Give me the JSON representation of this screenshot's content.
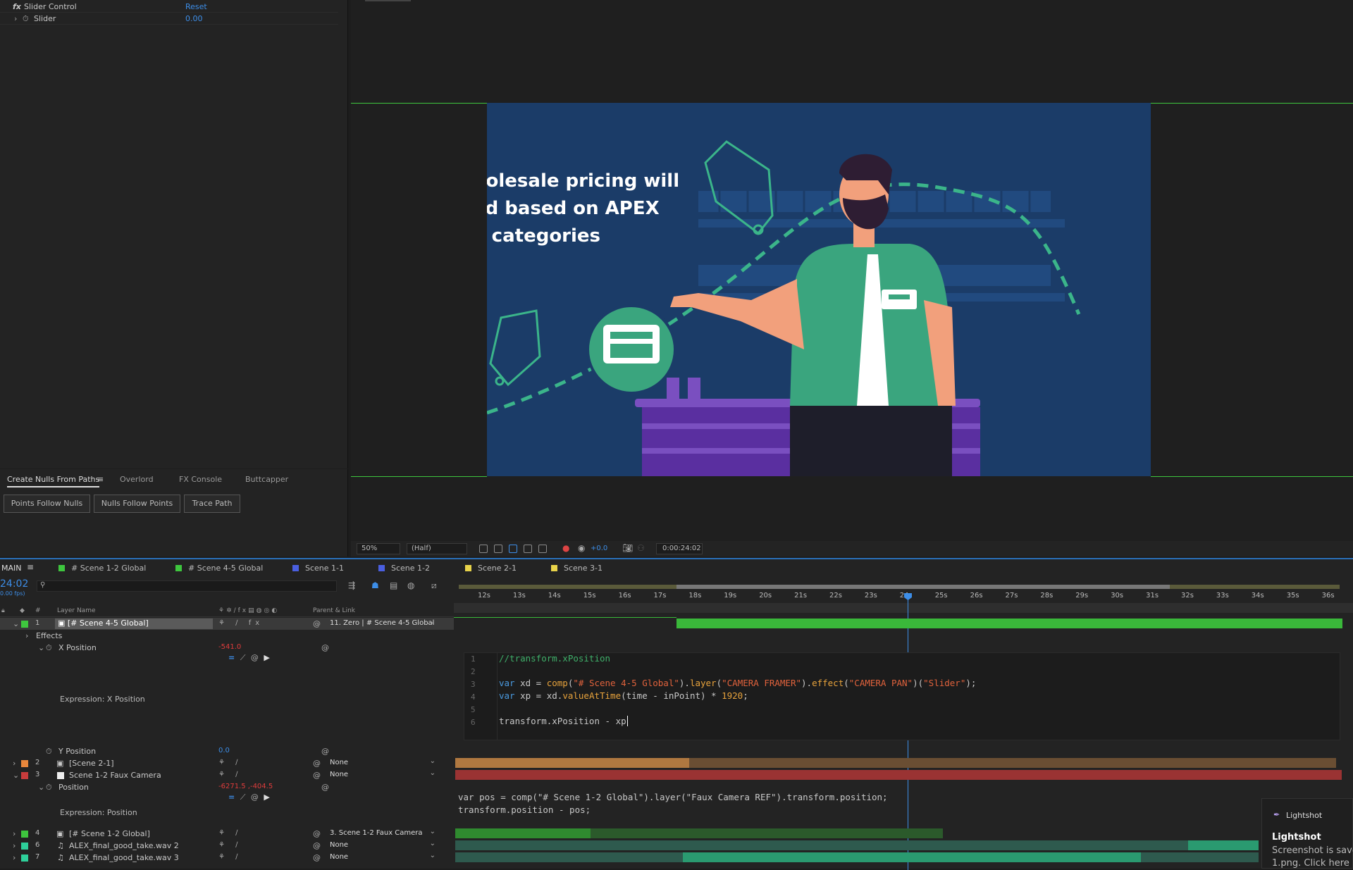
{
  "effect_controls": {
    "fx_label": "fx",
    "effect_name": "Slider Control",
    "reset_label": "Reset",
    "param_name": "Slider",
    "param_value": "0.00"
  },
  "script_panel": {
    "tabs": [
      "Create Nulls From Paths",
      "Overlord",
      "FX Console",
      "Buttcapper"
    ],
    "buttons": [
      "Points Follow Nulls",
      "Nulls Follow Points",
      "Trace Path"
    ]
  },
  "comp": {
    "text_lines": [
      "holesale pricing will",
      "ed based on APEX",
      "e categories"
    ]
  },
  "viewer_bar": {
    "zoom": "50%",
    "resolution": "(Half)",
    "exposure": "+0.0",
    "timecode": "0:00:24:02"
  },
  "timeline": {
    "panel_name": "MAIN",
    "timecode": "24:02",
    "fps": "0.00 fps)",
    "comp_tabs": [
      {
        "label": "# Scene 1-2 Global",
        "color": "#3ec63e"
      },
      {
        "label": "# Scene 4-5 Global",
        "color": "#3ec63e"
      },
      {
        "label": "Scene 1-1",
        "color": "#4a5fe0"
      },
      {
        "label": "Scene 1-2",
        "color": "#4a5fe0"
      },
      {
        "label": "Scene 2-1",
        "color": "#e8d34a"
      },
      {
        "label": "Scene 3-1",
        "color": "#e8d34a"
      }
    ],
    "headers": {
      "hash": "#",
      "layer_name": "Layer Name",
      "parent": "Parent & Link"
    },
    "ruler": [
      "12s",
      "13s",
      "14s",
      "15s",
      "16s",
      "17s",
      "18s",
      "19s",
      "20s",
      "21s",
      "22s",
      "23s",
      "24",
      "25s",
      "26s",
      "27s",
      "28s",
      "29s",
      "30s",
      "31s",
      "32s",
      "33s",
      "34s",
      "35s",
      "36s"
    ],
    "layers": [
      {
        "num": "1",
        "name": "[# Scene 4-5 Global]",
        "label_color": "#3ec63e",
        "parent": "11. Zero | # Scene 4-5 Global"
      },
      {
        "num": "2",
        "name": "[Scene 2-1]",
        "label_color": "#e8873c",
        "parent": "None"
      },
      {
        "num": "3",
        "name": "Scene 1-2 Faux Camera",
        "label_color": "#c83c3c",
        "parent": "None"
      },
      {
        "num": "4",
        "name": "[# Scene 1-2 Global]",
        "label_color": "#3ec63e",
        "parent": "3. Scene 1-2 Faux Camera"
      },
      {
        "num": "6",
        "name": "ALEX_final_good_take.wav 2",
        "label_color": "#2ecf9a",
        "parent": "None"
      },
      {
        "num": "7",
        "name": "ALEX_final_good_take.wav 3",
        "label_color": "#2ecf9a",
        "parent": "None"
      }
    ],
    "effects_label": "Effects",
    "xpos_label": "X Position",
    "xpos_value": "-541.0",
    "xpos_expr_label": "Expression: X Position",
    "ypos_label": "Y Position",
    "ypos_value": "0.0",
    "pos_label": "Position",
    "pos_value": "-6271.5 ,-404.5",
    "pos_expr_label": "Expression: Position",
    "expr1": {
      "lines": [
        "1",
        "2",
        "3",
        "4",
        "5",
        "6"
      ],
      "comment": "//transform.xPosition",
      "l3_kw": "var",
      "l3_a": " xd = ",
      "l3_fn": "comp",
      "l3_s1": "\"# Scene 4-5 Global\"",
      "l3_b": ").",
      "l3_fn2": "layer",
      "l3_s2": "\"CAMERA FRAMER\"",
      "l3_c": ").",
      "l3_fn3": "effect",
      "l3_s3": "\"CAMERA PAN\"",
      "l3_d": ")(",
      "l3_s4": "\"Slider\"",
      "l3_e": ");",
      "l4_kw": "var",
      "l4_a": " xp = xd.",
      "l4_fn": "valueAtTime",
      "l4_b": "(time - inPoint) * ",
      "l4_num": "1920",
      "l4_c": ";",
      "l6": "transform.xPosition - xp"
    },
    "expr2": {
      "line1": "var pos = comp(\"# Scene 1-2 Global\").layer(\"Faux Camera REF\").transform.position;",
      "line2": "transform.position - pos;"
    }
  },
  "lightshot": {
    "app": "Lightshot",
    "title": "Lightshot",
    "msg1": "Screenshot is save",
    "msg2": "1.png. Click here"
  }
}
